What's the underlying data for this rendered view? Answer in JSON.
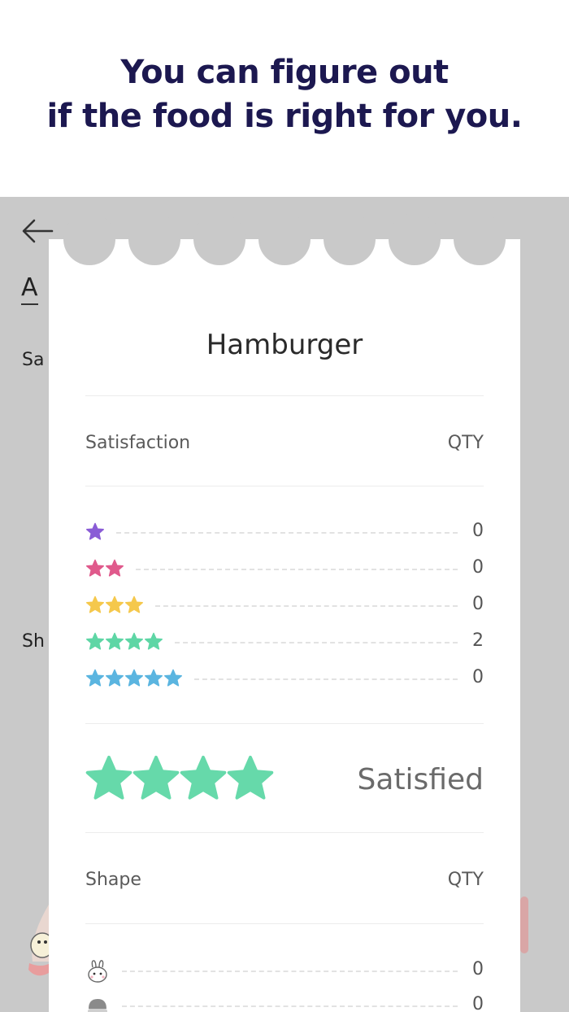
{
  "headline": {
    "line1": "You can figure out",
    "line2": "if the food is right for you."
  },
  "background": {
    "title_fragment": "A",
    "satisfaction_fragment": "Sa",
    "shape_fragment": "Sh"
  },
  "card": {
    "food_name": "Hamburger",
    "satisfaction_label": "Satisfaction",
    "qty_label": "QTY",
    "ratings": [
      {
        "stars": 1,
        "count": "0",
        "color": "#8a5cd6"
      },
      {
        "stars": 2,
        "count": "0",
        "color": "#e05a8c"
      },
      {
        "stars": 3,
        "count": "0",
        "color": "#f5c84c"
      },
      {
        "stars": 4,
        "count": "2",
        "color": "#5ed6a5"
      },
      {
        "stars": 5,
        "count": "0",
        "color": "#5bb5e0"
      }
    ],
    "summary": {
      "stars": 4,
      "label": "Satisfied",
      "color": "#66d9aa"
    },
    "shape_label": "Shape",
    "shape_qty_label": "QTY",
    "shapes": [
      {
        "icon": "bunny-icon",
        "count": "0"
      },
      {
        "icon": "bun-icon",
        "count": "0"
      }
    ]
  },
  "colors": {
    "headline": "#1c1850",
    "screen_bg": "#c9c9c9"
  }
}
